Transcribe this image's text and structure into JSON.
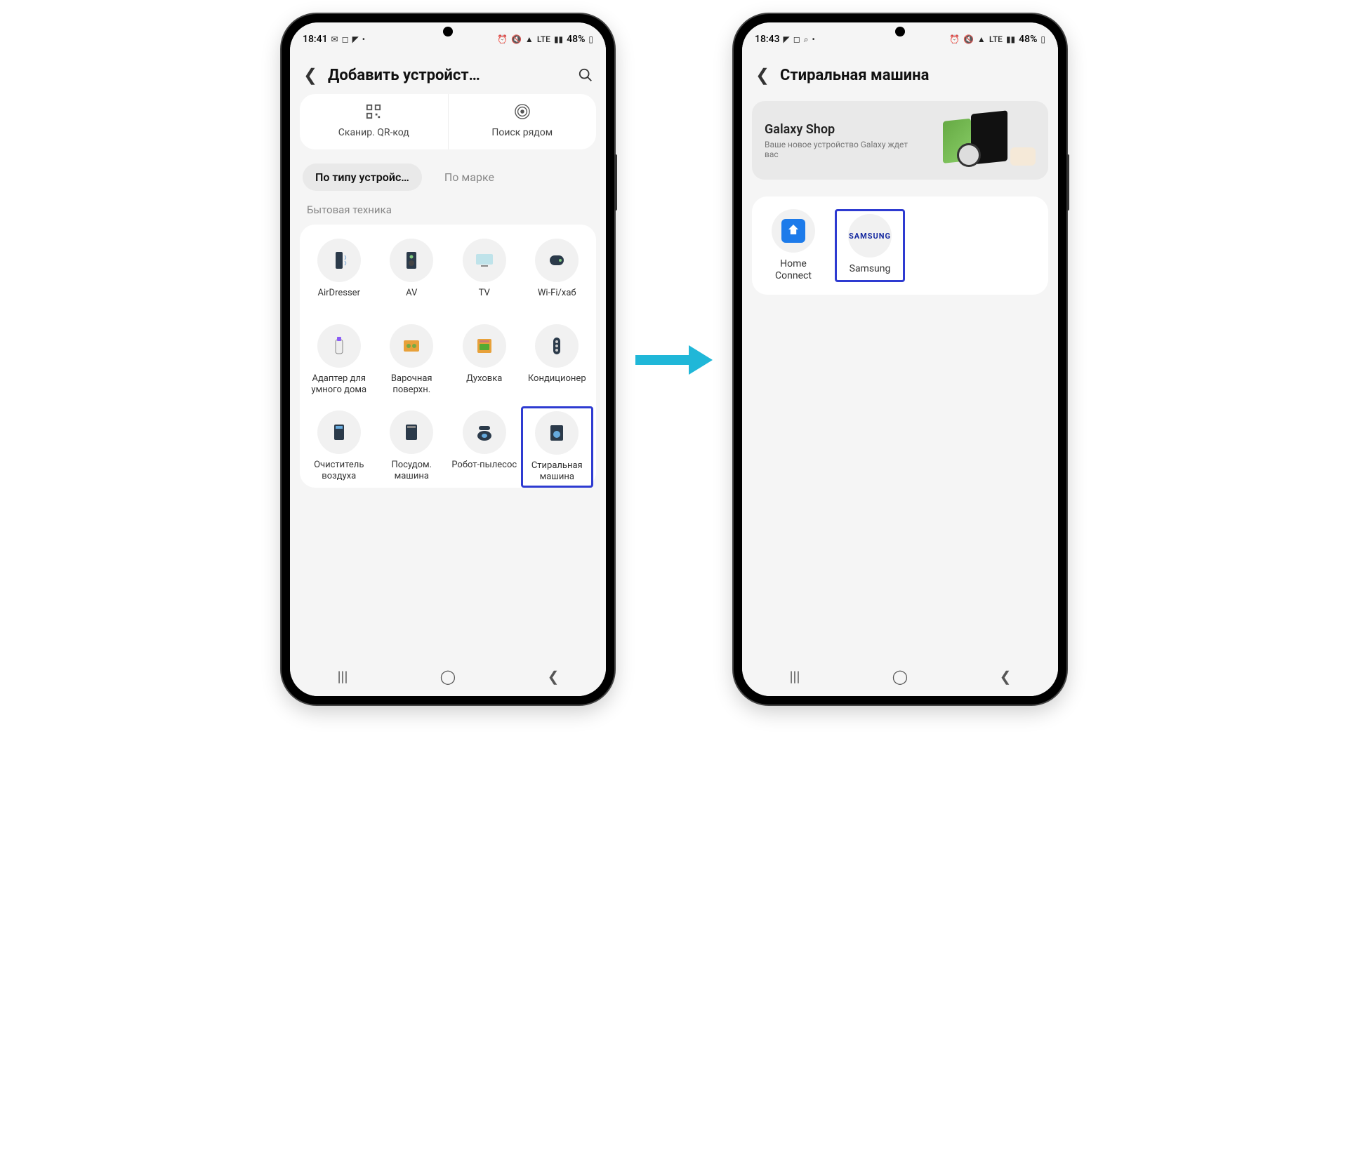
{
  "phone1": {
    "status": {
      "time": "18:41",
      "battery": "48%"
    },
    "header": {
      "title": "Добавить устройст…"
    },
    "actions": {
      "qr": "Сканир. QR-код",
      "nearby": "Поиск рядом"
    },
    "tabs": {
      "byType": "По типу устройс…",
      "byBrand": "По марке"
    },
    "section": "Бытовая техника",
    "devices": [
      "AirDresser",
      "AV",
      "TV",
      "Wi-Fi/хаб",
      "Адаптер для умного дома",
      "Варочная поверхн.",
      "Духовка",
      "Кондиционер",
      "Очиститель воздуха",
      "Посудом. машина",
      "Робот-пылесос",
      "Стиральная машина"
    ]
  },
  "phone2": {
    "status": {
      "time": "18:43",
      "battery": "48%"
    },
    "header": {
      "title": "Стиральная машина"
    },
    "banner": {
      "title": "Galaxy Shop",
      "sub": "Ваше новое устройство Galaxy ждет вас"
    },
    "brands": [
      {
        "label": "Home Connect"
      },
      {
        "label": "Samsung"
      }
    ]
  }
}
